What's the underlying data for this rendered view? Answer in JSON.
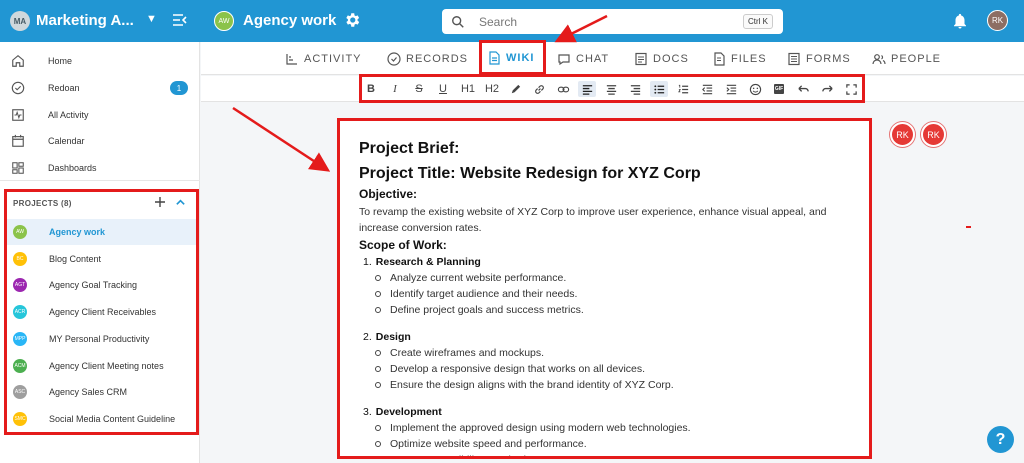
{
  "topbar": {
    "workspace_initials": "MA",
    "workspace_name": "Marketing A...",
    "project_initials": "AW",
    "project_title": "Agency work",
    "search_placeholder": "Search",
    "search_shortcut": "Ctrl K",
    "user_initials": "RK"
  },
  "sidebar": {
    "nav": [
      {
        "label": "Home",
        "icon": "home-icon"
      },
      {
        "label": "Redoan",
        "icon": "check-circle-icon",
        "badge": "1"
      },
      {
        "label": "All Activity",
        "icon": "activity-icon"
      },
      {
        "label": "Calendar",
        "icon": "calendar-icon"
      },
      {
        "label": "Dashboards",
        "icon": "dashboard-icon"
      }
    ],
    "projects_header": "PROJECTS (8)",
    "projects": [
      {
        "initials": "AW",
        "label": "Agency work",
        "color": "#8bc34a"
      },
      {
        "initials": "BC",
        "label": "Blog Content",
        "color": "#ffc107"
      },
      {
        "initials": "AGT",
        "label": "Agency Goal Tracking",
        "color": "#9c27b0"
      },
      {
        "initials": "ACR",
        "label": "Agency Client Receivables",
        "color": "#26c6da"
      },
      {
        "initials": "MPP",
        "label": "MY Personal Productivity",
        "color": "#29b6f6"
      },
      {
        "initials": "ACM",
        "label": "Agency Client Meeting notes",
        "color": "#4caf50"
      },
      {
        "initials": "ASC",
        "label": "Agency Sales CRM",
        "color": "#9e9e9e"
      },
      {
        "initials": "SMC",
        "label": "Social Media Content Guideline",
        "color": "#ffc107"
      }
    ]
  },
  "tabs": [
    {
      "label": "ACTIVITY",
      "icon": "activity-tab-icon"
    },
    {
      "label": "RECORDS",
      "icon": "records-icon"
    },
    {
      "label": "WIKI",
      "icon": "wiki-icon",
      "active": true
    },
    {
      "label": "CHAT",
      "icon": "chat-icon"
    },
    {
      "label": "DOCS",
      "icon": "docs-icon"
    },
    {
      "label": "FILES",
      "icon": "files-icon"
    },
    {
      "label": "FORMS",
      "icon": "forms-icon"
    },
    {
      "label": "PEOPLE",
      "icon": "people-icon"
    }
  ],
  "toolbar": {
    "bold": "B",
    "italic": "I",
    "strike": "S",
    "underline": "U",
    "h1": "H1",
    "h2": "H2",
    "gif": "GIF"
  },
  "wiki": {
    "title1": "Project Brief:",
    "title2": "Project Title: Website Redesign for XYZ Corp",
    "objective_heading": "Objective:",
    "objective_text": "To revamp the existing website of XYZ Corp to improve user experience, enhance visual appeal, and increase conversion rates.",
    "scope_heading": "Scope of Work:",
    "sections": [
      {
        "num": "1.",
        "title": "Research & Planning",
        "items": [
          "Analyze current website performance.",
          "Identify target audience and their needs.",
          "Define project goals and success metrics."
        ]
      },
      {
        "num": "2.",
        "title": "Design",
        "items": [
          "Create wireframes and mockups.",
          "Develop a responsive design that works on all devices.",
          "Ensure the design aligns with the brand identity of XYZ Corp."
        ]
      },
      {
        "num": "3.",
        "title": "Development",
        "items": [
          "Implement the approved design using modern web technologies.",
          "Optimize website speed and performance.",
          "Ensure accessibility standards are met."
        ]
      }
    ]
  },
  "presence": [
    "RK",
    "RK"
  ],
  "help_label": "?",
  "colors": {
    "brand": "#2196d3",
    "annotation": "#e41b1b"
  }
}
